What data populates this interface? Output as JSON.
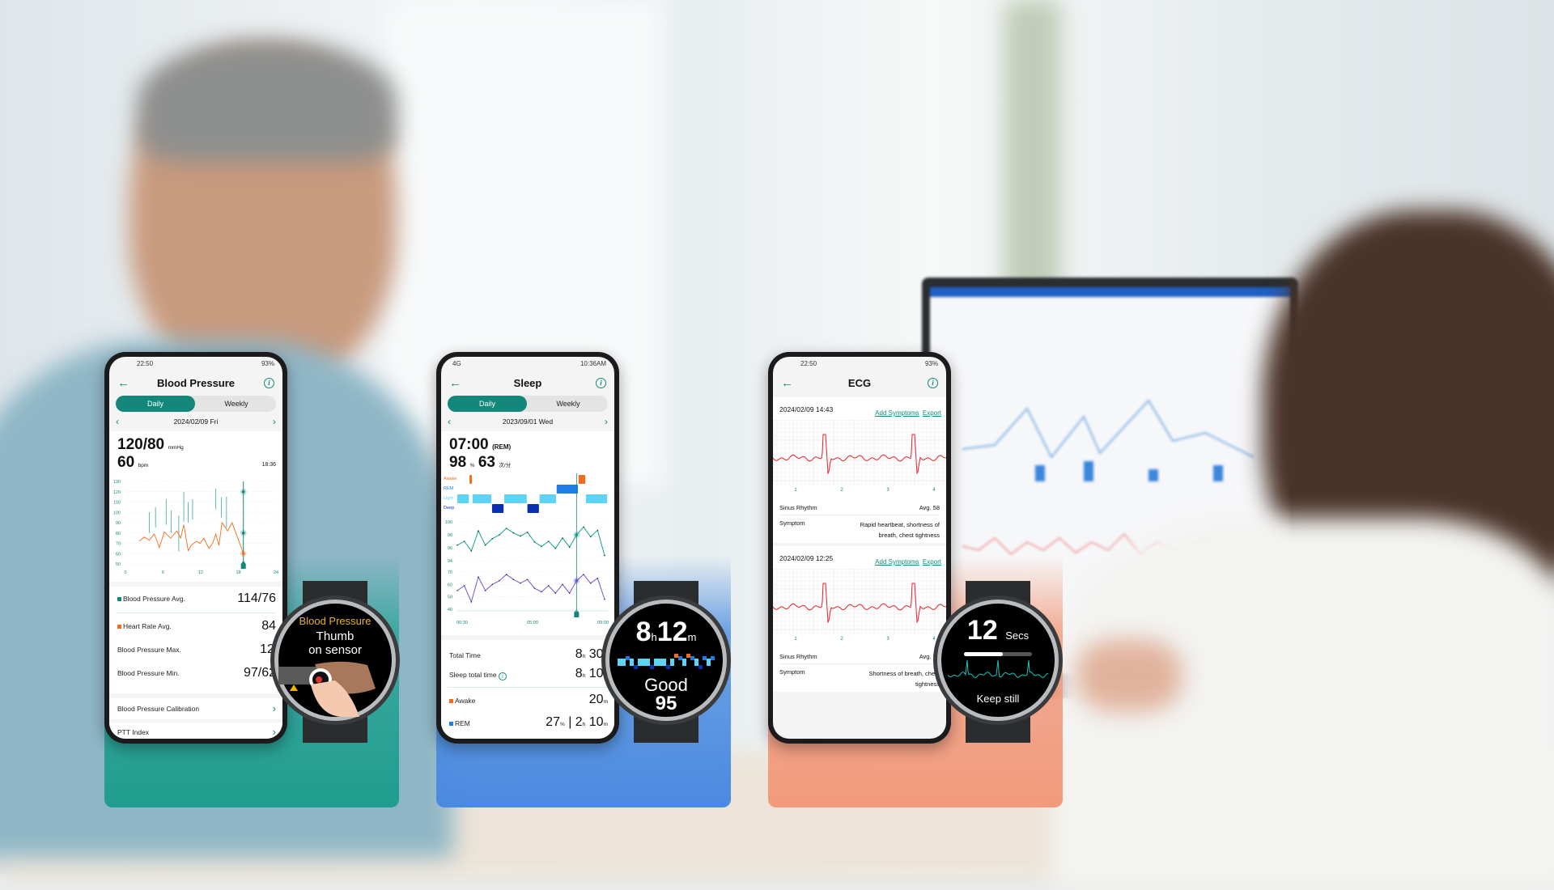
{
  "colors": {
    "teal": "#13877a",
    "orange": "#f26a1b",
    "ecg_red": "#e8202a",
    "panel_teal": "#2aa597",
    "panel_blue": "#4f8fe0",
    "panel_salmon": "#f29a7c"
  },
  "bp_phone": {
    "status_time": "22:50",
    "battery": "93%",
    "title": "Blood Pressure",
    "tabs": [
      "Daily",
      "Weekly"
    ],
    "date": "2024/02/09 Fri",
    "bp_value": "120/80",
    "bp_unit": "mmHg",
    "hr_value": "60",
    "hr_unit": "bpm",
    "time": "18:36",
    "stats": [
      {
        "label": "Blood Pressure Avg.",
        "value": "114/76",
        "marker": "teal"
      },
      {
        "label": "Heart Rate Avg.",
        "value": "84",
        "marker": "orange"
      },
      {
        "label": "Blood Pressure Max.",
        "value": "124/102"
      },
      {
        "label": "Blood Pressure Min.",
        "value": "97/62"
      }
    ],
    "links": [
      "Blood Pressure Calibration",
      "PTT Index"
    ]
  },
  "sleep_phone": {
    "status_time": "10:36AM",
    "network": "4G",
    "title": "Sleep",
    "tabs": [
      "Daily",
      "Weekly"
    ],
    "date": "2023/09/01 Wed",
    "time": "07:00",
    "stage": "(REM)",
    "spo2": "98",
    "spo2_unit": "%",
    "hr": "63",
    "hr_unit": "次/分",
    "stage_labels": [
      "Awake",
      "REM",
      "Light",
      "Deep"
    ],
    "stats": [
      {
        "label": "Total Time",
        "value": "8",
        "u1": "h",
        "value2": "30",
        "u2": "m"
      },
      {
        "label": "Sleep total time",
        "value": "8",
        "u1": "h",
        "value2": "10",
        "u2": "m",
        "info": true
      },
      {
        "label": "Awake",
        "value": "20",
        "u1": "m",
        "marker": "orange"
      },
      {
        "label": "REM",
        "pct": "27",
        "value": "2",
        "u1": "h",
        "value2": "10",
        "u2": "m",
        "marker": "blue"
      }
    ]
  },
  "ecg_phone": {
    "status_time": "22:50",
    "battery": "93%",
    "title": "ECG",
    "records": [
      {
        "datetime": "2024/02/09 14:43",
        "add": "Add Symptoms",
        "export": "Export",
        "rhythm": "Sinus Rhythm",
        "avg": "Avg. 58",
        "symptom_label": "Symptom",
        "symptom": "Rapid heartbeat, shortness of breath, chest tightness",
        "ticks": [
          "1",
          "2",
          "3",
          "4"
        ]
      },
      {
        "datetime": "2024/02/09 12:25",
        "add": "Add Symptoms",
        "export": "Export",
        "rhythm": "Sinus Rhythm",
        "avg": "Avg. 58",
        "symptom_label": "Symptom",
        "symptom": "Shortness of breath, chest tightness",
        "ticks": [
          "1",
          "2",
          "3",
          "4"
        ]
      }
    ]
  },
  "watches": {
    "bp": {
      "title": "Blood Pressure",
      "line1": "Thumb",
      "line2": "on sensor"
    },
    "sleep": {
      "hours": "8",
      "h": "h",
      "minutes": "12",
      "m": "m",
      "quality": "Good",
      "score": "95"
    },
    "ecg": {
      "seconds": "12",
      "unit": "Secs",
      "progress": 0.57,
      "message": "Keep still"
    }
  },
  "chart_data": [
    {
      "type": "line",
      "name": "bp-daily",
      "xlim": [
        0,
        24
      ],
      "ylim": [
        50,
        130
      ],
      "xticks": [
        "0",
        "6",
        "12",
        "18",
        "24"
      ],
      "yticks": [
        "130",
        "120",
        "110",
        "100",
        "90",
        "80",
        "70",
        "60",
        "50"
      ],
      "heart_rate": [
        [
          2.2,
          72
        ],
        [
          3,
          76
        ],
        [
          3.8,
          73
        ],
        [
          4.6,
          79
        ],
        [
          5.4,
          66
        ],
        [
          6.2,
          81
        ],
        [
          7.2,
          75
        ],
        [
          8.2,
          82
        ],
        [
          8.8,
          75
        ],
        [
          9.3,
          88
        ],
        [
          10,
          63
        ],
        [
          10.5,
          68
        ],
        [
          11.3,
          72
        ],
        [
          11.9,
          70
        ],
        [
          12.5,
          75
        ],
        [
          13.3,
          65
        ],
        [
          13.9,
          70
        ],
        [
          14.4,
          79
        ],
        [
          14.9,
          68
        ],
        [
          15.4,
          90
        ],
        [
          16.3,
          82
        ],
        [
          17,
          90
        ],
        [
          18.8,
          60
        ]
      ],
      "bp_ranges": [
        [
          3.8,
          80,
          100
        ],
        [
          4.8,
          85,
          105
        ],
        [
          6.5,
          88,
          113
        ],
        [
          7.3,
          80,
          102
        ],
        [
          8.5,
          62,
          97
        ],
        [
          9.3,
          91,
          120
        ],
        [
          10,
          90,
          110
        ],
        [
          10.7,
          93,
          113
        ],
        [
          14.4,
          103,
          123
        ],
        [
          15.3,
          95,
          115
        ],
        [
          16.1,
          85,
          115
        ]
      ],
      "selected": {
        "x": 18.8,
        "systolic": 120,
        "diastolic": 80,
        "hr": 60
      }
    },
    {
      "type": "line",
      "name": "sleep-daily",
      "xticks": [
        "00:30",
        "05:00",
        "09:00"
      ],
      "stages": [
        "light",
        "awake",
        "light",
        "deep",
        "light",
        "deep",
        "light",
        "rem",
        "awake",
        "light"
      ],
      "stage_durations": [
        1,
        0.25,
        1.6,
        1,
        1.9,
        1,
        1.4,
        1.8,
        0.6,
        1.8
      ],
      "spo2_ylim": [
        94,
        100
      ],
      "spo2_yticks": [
        "100",
        "98",
        "96",
        "94"
      ],
      "spo2": [
        96.4,
        97,
        95.5,
        98.6,
        96.4,
        97.4,
        98,
        99,
        98.3,
        97.8,
        98.4,
        96.9,
        96.2,
        97,
        95.9,
        97.5,
        96.1,
        98,
        99.2,
        97.7,
        98.7,
        94.8
      ],
      "hr_ylim": [
        40,
        70
      ],
      "hr_yticks": [
        "70",
        "60",
        "50",
        "40"
      ],
      "hr": [
        55,
        59,
        46,
        66,
        55,
        60,
        63,
        68,
        64,
        61,
        64,
        57,
        54,
        59,
        53,
        60,
        53,
        63,
        68,
        61,
        65,
        48
      ],
      "selected_index": 17
    }
  ]
}
